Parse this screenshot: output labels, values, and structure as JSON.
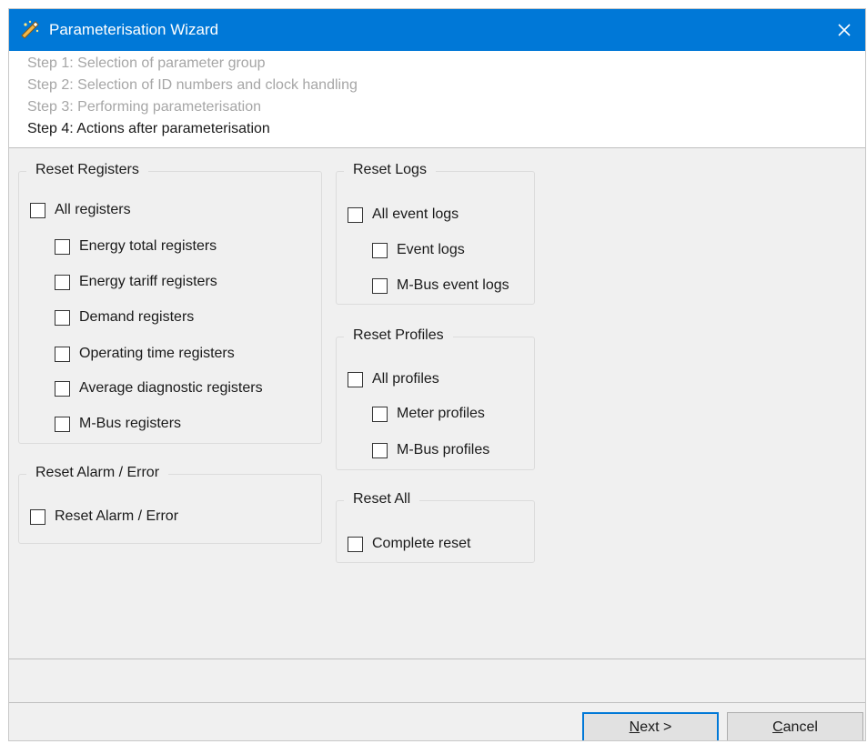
{
  "window": {
    "title": "Parameterisation Wizard"
  },
  "steps": [
    "Step 1: Selection of parameter group",
    "Step 2: Selection of ID numbers and clock handling",
    "Step 3: Performing parameterisation",
    "Step 4: Actions after parameterisation"
  ],
  "reset_registers": {
    "title": "Reset Registers",
    "all": "All registers",
    "items": [
      "Energy total registers",
      "Energy tariff registers",
      "Demand registers",
      "Operating time registers",
      "Average diagnostic registers",
      "M-Bus registers"
    ]
  },
  "reset_alarm": {
    "title": "Reset Alarm / Error",
    "item": "Reset Alarm / Error"
  },
  "reset_logs": {
    "title": "Reset Logs",
    "all": "All event logs",
    "items": [
      "Event logs",
      "M-Bus event logs"
    ]
  },
  "reset_profiles": {
    "title": "Reset Profiles",
    "all": "All profiles",
    "items": [
      "Meter profiles",
      "M-Bus profiles"
    ]
  },
  "reset_all": {
    "title": "Reset All",
    "item": "Complete reset"
  },
  "buttons": {
    "next": "Next >",
    "cancel": "Cancel"
  },
  "colors": {
    "titlebar": "#0078d7",
    "background": "#f0f0f0"
  },
  "icons": {
    "app": "wizard-wand-icon",
    "close": "close-icon"
  }
}
